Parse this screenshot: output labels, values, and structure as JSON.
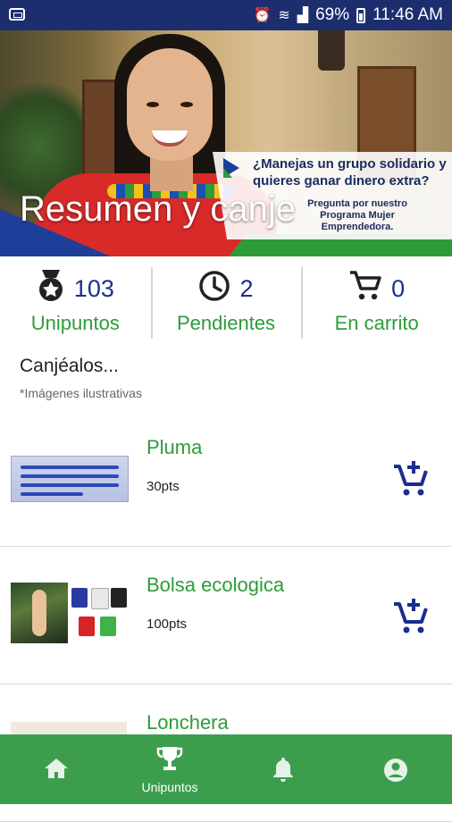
{
  "status_bar": {
    "battery": "69%",
    "time": "11:46 AM"
  },
  "banner": {
    "title": "Resumen y canje",
    "promo_question": "¿Manejas un grupo solidario y quieres ganar dinero extra?",
    "promo_subtext": "Pregunta por nuestro Programa Mujer Emprendedora."
  },
  "stats": [
    {
      "icon": "medal-icon",
      "value": "103",
      "label": "Unipuntos"
    },
    {
      "icon": "clock-icon",
      "value": "2",
      "label": "Pendientes"
    },
    {
      "icon": "cart-icon",
      "value": "0",
      "label": "En carrito"
    }
  ],
  "catalog": {
    "title": "Canjéalos...",
    "note": "*Imágenes ilustrativas",
    "items": [
      {
        "name": "Pluma",
        "points": "30pts"
      },
      {
        "name": "Bolsa ecologica",
        "points": "100pts"
      },
      {
        "name": "Lonchera",
        "points": ""
      }
    ]
  },
  "bottom_nav": {
    "items": [
      {
        "icon": "home-icon",
        "label": ""
      },
      {
        "icon": "trophy-icon",
        "label": "Unipuntos",
        "active": true
      },
      {
        "icon": "bell-icon",
        "label": ""
      },
      {
        "icon": "account-icon",
        "label": ""
      }
    ]
  },
  "colors": {
    "status_bar": "#1d2e6f",
    "accent_green": "#2e9b3a",
    "accent_blue": "#1a2f8c",
    "nav_green": "#3c9e4d"
  }
}
